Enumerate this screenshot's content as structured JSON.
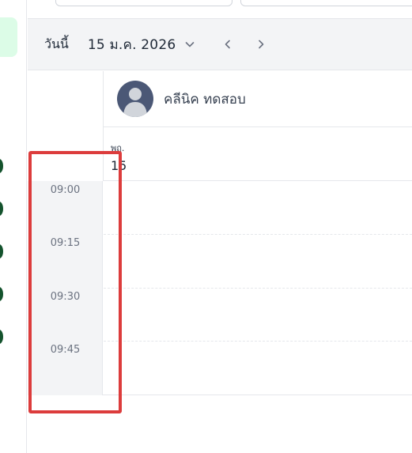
{
  "toolbar": {
    "today_label": "วันนี้",
    "date_label": "15 ม.ค. 2026"
  },
  "resource": {
    "name": "คลีนิค ทดสอบ"
  },
  "day": {
    "weekday": "พฤ.",
    "number": "15"
  },
  "time_slots": [
    "09:00",
    "09:15",
    "09:30",
    "09:45"
  ],
  "icons": {
    "date_dropdown": "chevron-down-icon",
    "prev": "chevron-left-icon",
    "next": "chevron-right-icon",
    "avatar": "user-avatar-icon"
  },
  "colors": {
    "nav_active_bg": "#dcfce7",
    "nav_dot": "#14532d",
    "highlight": "#dc3c3c",
    "avatar_bg": "#4b5876"
  }
}
